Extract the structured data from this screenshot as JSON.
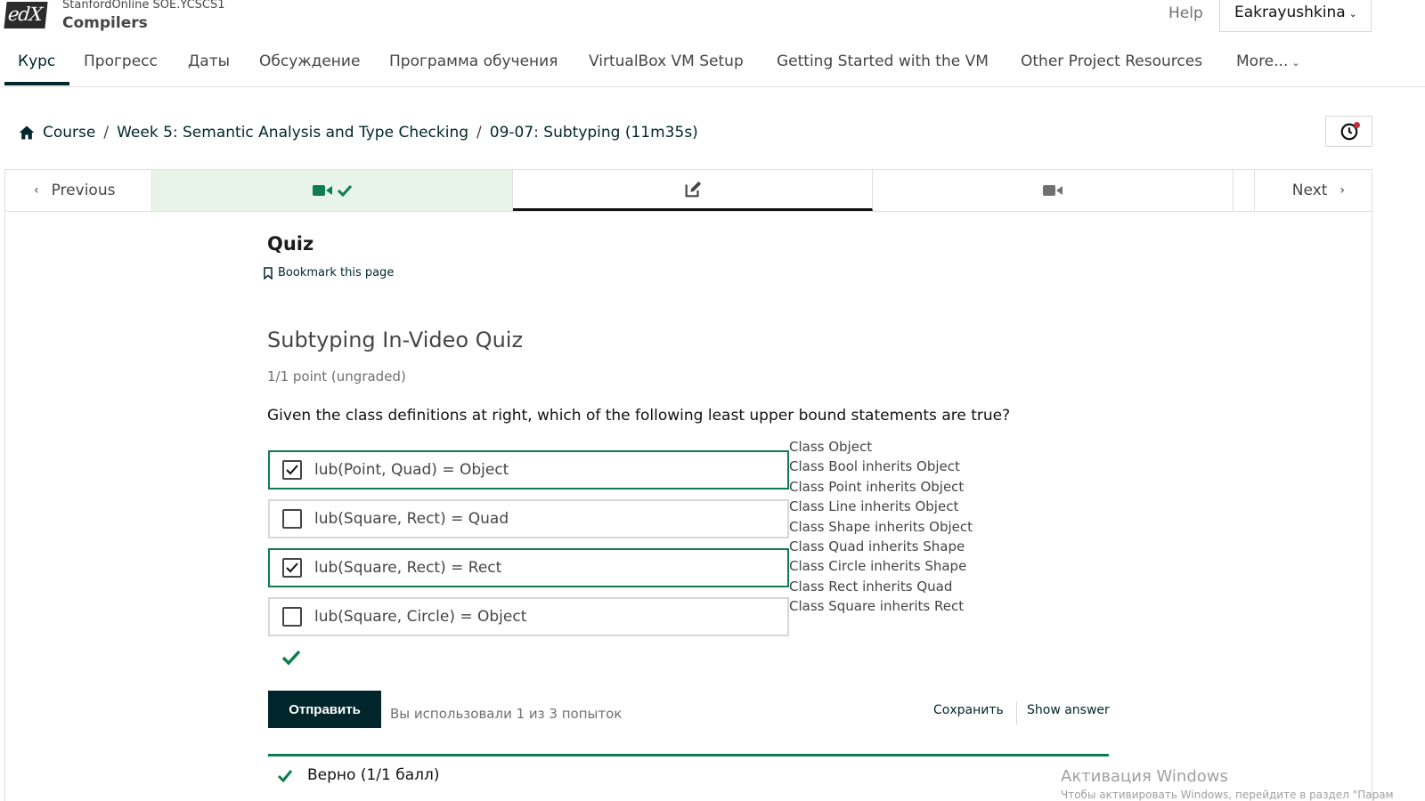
{
  "header": {
    "logo_text": "edX",
    "course_org": "StanfordOnline SOE.YCSCS1",
    "course_title": "Compilers",
    "help_label": "Help",
    "username": "Eakrayushkina"
  },
  "tabs": [
    {
      "label": "Курс",
      "active": true
    },
    {
      "label": "Прогресс"
    },
    {
      "label": "Даты"
    },
    {
      "label": "Обсуждение"
    },
    {
      "label": "Программа обучения"
    },
    {
      "label": "VirtualBox VM Setup"
    },
    {
      "label": "Getting Started with the VM"
    },
    {
      "label": "Other Project Resources"
    },
    {
      "label": "More..."
    }
  ],
  "breadcrumb": {
    "items": [
      "Course",
      "Week 5: Semantic Analysis and Type Checking",
      "09-07: Subtyping (11m35s)"
    ],
    "separator": "/"
  },
  "sequence": {
    "previous_label": "Previous",
    "next_label": "Next",
    "units": [
      {
        "icon": "video-icon",
        "completed": true
      },
      {
        "icon": "edit-icon",
        "current": true
      },
      {
        "icon": "video-icon"
      }
    ]
  },
  "unit": {
    "title": "Quiz",
    "bookmark_label": "Bookmark this page"
  },
  "problem": {
    "title": "Subtyping In-Video Quiz",
    "points": "1/1 point (ungraded)",
    "question": "Given the class definitions at right, which of the following least upper bound statements are true?",
    "choices": [
      {
        "label": "lub(Point, Quad) = Object",
        "checked": true
      },
      {
        "label": "lub(Square, Rect) = Quad",
        "checked": false
      },
      {
        "label": "lub(Square, Rect) = Rect",
        "checked": true
      },
      {
        "label": "lub(Square, Circle) = Object",
        "checked": false
      }
    ],
    "class_definitions": [
      "Class Object",
      "Class Bool inherits Object",
      "Class Point inherits Object",
      "Class Line inherits Object",
      "Class Shape inherits Object",
      "Class Quad inherits Shape",
      "Class Circle inherits Shape",
      "Class Rect inherits Quad",
      "Class Square inherits Rect"
    ],
    "submit_label": "Отправить",
    "attempts_text": "Вы использовали 1 из 3 попыток",
    "save_label": "Сохранить",
    "show_answer_label": "Show answer",
    "result_text": "Верно (1/1 балл)"
  },
  "watermark": {
    "title": "Активация Windows",
    "subtitle": "Чтобы активировать Windows, перейдите в раздел \"Парам"
  },
  "colors": {
    "primary": "#00262b",
    "success": "#0d7d4d",
    "completed_bg": "#e8f4e8",
    "notification": "#c32d3a"
  }
}
